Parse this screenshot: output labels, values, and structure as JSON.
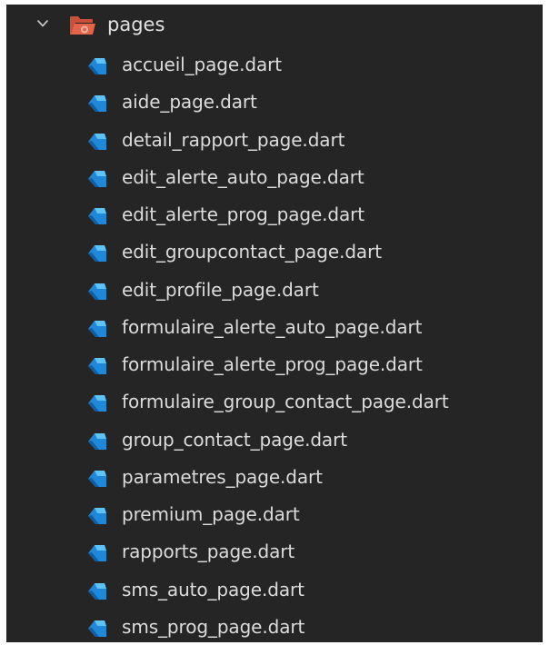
{
  "explorer": {
    "folder": {
      "name": "pages",
      "expanded": true,
      "chevron_icon": "chevron-down-icon",
      "folder_icon": "folder-open-icon",
      "folder_color": "#e2654a"
    },
    "file_icon": "dart-icon",
    "dart_color": "#1f88d9",
    "files": [
      "accueil_page.dart",
      "aide_page.dart",
      "detail_rapport_page.dart",
      "edit_alerte_auto_page.dart",
      "edit_alerte_prog_page.dart",
      "edit_groupcontact_page.dart",
      "edit_profile_page.dart",
      "formulaire_alerte_auto_page.dart",
      "formulaire_alerte_prog_page.dart",
      "formulaire_group_contact_page.dart",
      "group_contact_page.dart",
      "parametres_page.dart",
      "premium_page.dart",
      "rapports_page.dart",
      "sms_auto_page.dart",
      "sms_prog_page.dart"
    ]
  }
}
